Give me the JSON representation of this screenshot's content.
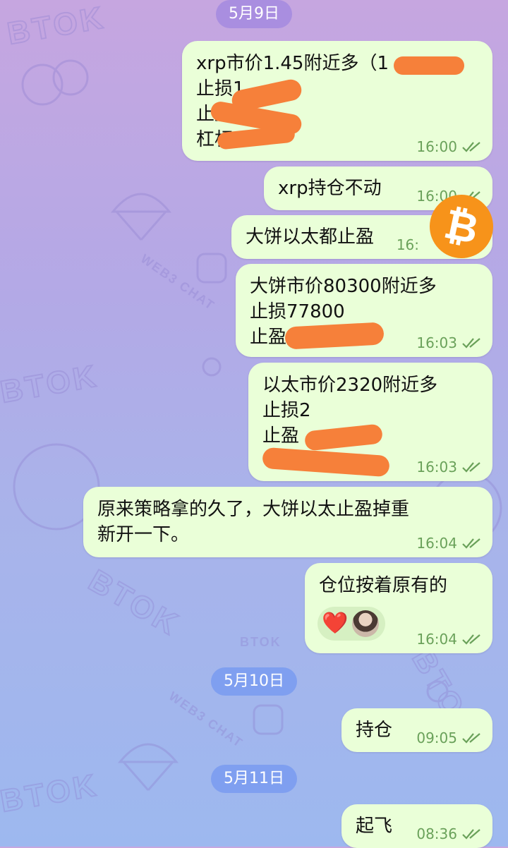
{
  "colors": {
    "bubble_bg": "#eaffd8",
    "meta_green": "#6aa15a",
    "date_pill_purple": "#a98ee0",
    "date_pill_blue": "#7f9ff0",
    "redaction_orange": "#f6803a",
    "bitcoin_orange": "#f7931a"
  },
  "wallpaper": {
    "brand": "BTOK",
    "tag": "WEB3 CHAT"
  },
  "dates": [
    "5月9日",
    "5月10日",
    "5月11日"
  ],
  "messages": [
    {
      "lines": [
        "xrp市价1.45附近多（1",
        "止损1.",
        "止盈",
        "杠杆20"
      ],
      "time": "16:00"
    },
    {
      "lines": [
        "xrp持仓不动"
      ],
      "time": "16:00"
    },
    {
      "lines": [
        "大饼以太都止盈"
      ],
      "time": "16:"
    },
    {
      "lines": [
        "大饼市价80300附近多",
        "止损77800",
        "止盈8"
      ],
      "time": "16:03"
    },
    {
      "lines": [
        "以太市价2320附近多",
        "",
        "止损2",
        "止盈"
      ],
      "time": "16:03"
    },
    {
      "lines": [
        "原来策略拿的久了，大饼以太止盈掉重",
        "新开一下。"
      ],
      "time": "16:04"
    },
    {
      "lines": [
        "仓位按着原有的"
      ],
      "time": "16:04",
      "reaction": "❤️"
    },
    {
      "lines": [
        "持仓"
      ],
      "time": "09:05"
    },
    {
      "lines": [
        "起飞"
      ],
      "time": "08:36"
    }
  ],
  "bitcoin_badge": "₿"
}
